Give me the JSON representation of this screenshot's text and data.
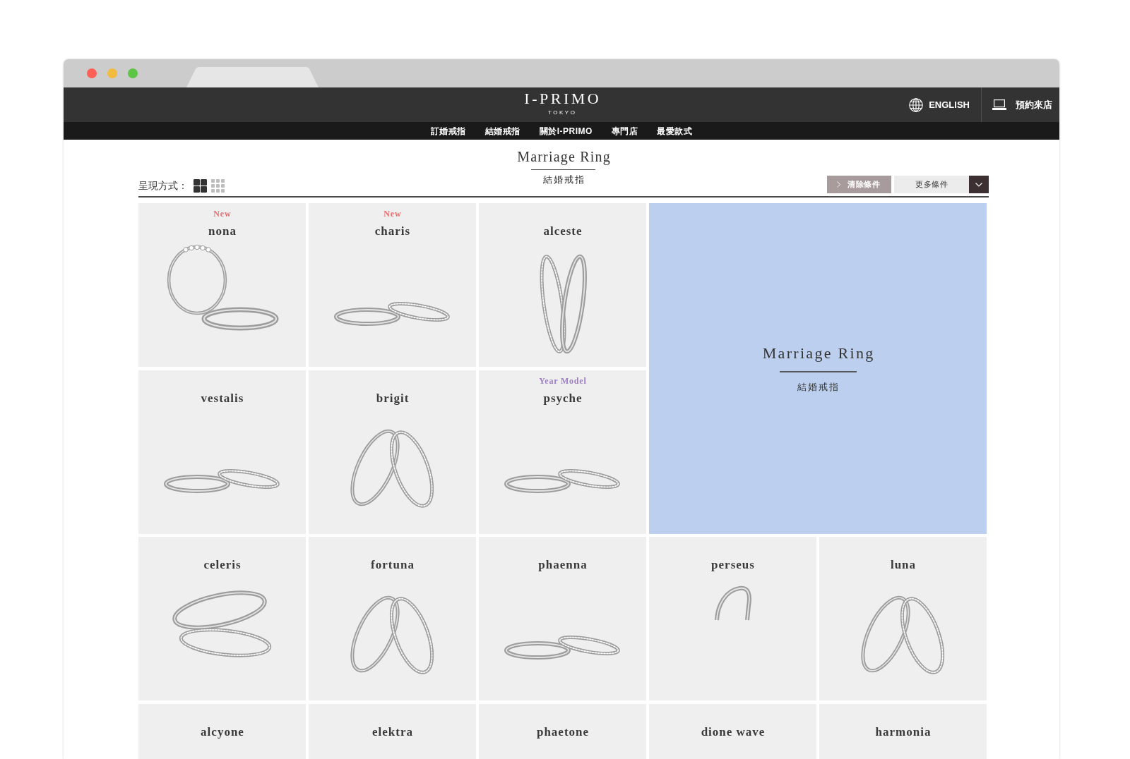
{
  "header": {
    "logo": "I-PRIMO",
    "logo_tagline": "TOKYO",
    "language_link": "ENGLISH",
    "reservation_link": "預約來店"
  },
  "nav": [
    {
      "label": "訂婚戒指"
    },
    {
      "label": "結婚戒指"
    },
    {
      "label": "關於I-PRIMO"
    },
    {
      "label": "專門店"
    },
    {
      "label": "最愛款式"
    }
  ],
  "page": {
    "title": "Marriage Ring",
    "subtitle": "結婚戒指"
  },
  "toolbar": {
    "view_label": "呈現方式：",
    "views": [
      {
        "kind": "large",
        "selected": true
      },
      {
        "kind": "small",
        "selected": false
      }
    ],
    "filters": [
      {
        "kind": "clear",
        "label": "清除條件"
      },
      {
        "kind": "more",
        "label": "更多條件"
      }
    ]
  },
  "feature": {
    "title": "Marriage Ring",
    "subtitle": "結婚戒指"
  },
  "products": [
    {
      "name": "nona",
      "badge": {
        "text": "New",
        "color": "#ea6d6d"
      },
      "kind": "standing"
    },
    {
      "name": "charis",
      "badge": {
        "text": "New",
        "color": "#ea6d6d"
      },
      "kind": "lying"
    },
    {
      "name": "alceste",
      "kind": "upright"
    },
    {
      "name": "vestalis",
      "kind": "lying"
    },
    {
      "name": "brigit",
      "kind": "leaning"
    },
    {
      "name": "psyche",
      "badge": {
        "text": "Year Model",
        "color": "#9c7dc3"
      },
      "kind": "lying"
    },
    {
      "name": "celeris",
      "kind": "stacked"
    },
    {
      "name": "fortuna",
      "kind": "leaning"
    },
    {
      "name": "phaenna",
      "kind": "lying"
    },
    {
      "name": "perseus",
      "kind": "partial"
    },
    {
      "name": "luna",
      "kind": "leaning"
    },
    {
      "name": "alcyone",
      "kind": "plain"
    },
    {
      "name": "elektra",
      "kind": "plain"
    },
    {
      "name": "phaetone",
      "kind": "plain"
    },
    {
      "name": "dione wave",
      "kind": "plain"
    },
    {
      "name": "harmonia",
      "kind": "plain"
    }
  ]
}
